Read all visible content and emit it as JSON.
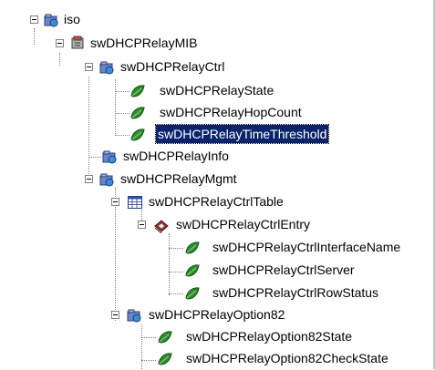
{
  "tree": {
    "nodes": [
      {
        "label": "iso",
        "icon": "folder-globe-icon"
      },
      {
        "label": "swDHCPRelayMIB",
        "icon": "mib-module-icon"
      },
      {
        "label": "swDHCPRelayCtrl",
        "icon": "folder-globe-icon"
      },
      {
        "label": "swDHCPRelayState",
        "icon": "leaf-icon"
      },
      {
        "label": "swDHCPRelayHopCount",
        "icon": "leaf-icon"
      },
      {
        "label": "swDHCPRelayTimeThreshold",
        "icon": "leaf-icon",
        "selected": true
      },
      {
        "label": "swDHCPRelayInfo",
        "icon": "folder-globe-icon"
      },
      {
        "label": "swDHCPRelayMgmt",
        "icon": "folder-globe-icon"
      },
      {
        "label": "swDHCPRelayCtrlTable",
        "icon": "table-icon"
      },
      {
        "label": "swDHCPRelayCtrlEntry",
        "icon": "entry-icon"
      },
      {
        "label": "swDHCPRelayCtrlInterfaceName",
        "icon": "leaf-icon"
      },
      {
        "label": "swDHCPRelayCtrlServer",
        "icon": "leaf-icon"
      },
      {
        "label": "swDHCPRelayCtrlRowStatus",
        "icon": "leaf-icon"
      },
      {
        "label": "swDHCPRelayOption82",
        "icon": "folder-globe-icon"
      },
      {
        "label": "swDHCPRelayOption82State",
        "icon": "leaf-icon"
      },
      {
        "label": "swDHCPRelayOption82CheckState",
        "icon": "leaf-icon"
      }
    ]
  },
  "colors": {
    "selection_bg": "#0a246a",
    "leaf_green": "#2e8b2e",
    "folder_blue": "#6a86c8",
    "entry_red": "#cc2222"
  }
}
